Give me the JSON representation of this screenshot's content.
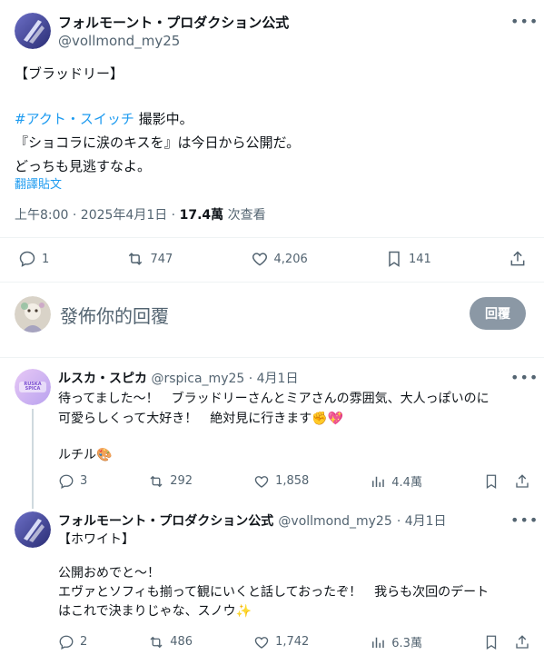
{
  "main_post": {
    "author_name": "フォルモーント・プロダクション公式",
    "author_handle": "@vollmond_my25",
    "line1": "【ブラッドリー】",
    "hashtag": "#アクト・スイッチ",
    "line2_rest": " 撮影中。",
    "line3": "『ショコラに涙のキスを』は今日から公開だ。",
    "line4": "どっちも見逃すなよ。",
    "translate": "翻譯貼文",
    "time": "上午8:00 · 2025年4月1日 · ",
    "views_count": "17.4萬",
    "views_label": " 次查看",
    "replies": "1",
    "reposts": "747",
    "likes": "4,206",
    "bookmarks": "141"
  },
  "composer": {
    "placeholder": "發佈你的回覆",
    "reply_button": "回覆"
  },
  "replies": [
    {
      "author_name": "ルスカ・スピカ",
      "author_handle": "@rspica_my25",
      "date": "· 4月1日",
      "avatar_text": "RUSKA SPICA",
      "line1": "待ってました～！　ブラッドリーさんとミアさんの雰囲気、大人っぽいのに",
      "line2": "可愛らしくって大好き！　絶対見に行きます✊💖",
      "line3": "",
      "line4": "ルチル🎨",
      "replies": "3",
      "reposts": "292",
      "likes": "1,858",
      "views": "4.4萬"
    },
    {
      "author_name": "フォルモーント・プロダクション公式",
      "author_handle": "@vollmond_my25",
      "date": "· 4月1日",
      "line1": "【ホワイト】",
      "line2": "",
      "line3": "公開おめでと～！",
      "line4": "エヴァとソフィも揃って観にいくと話しておったぞ！　我らも次回のデート",
      "line5": "はこれで決まりじゃな、スノウ✨",
      "replies": "2",
      "reposts": "486",
      "likes": "1,742",
      "views": "6.3萬"
    }
  ],
  "colors": {
    "accent": "#1d9bf0",
    "muted": "#536471",
    "divider": "#eff3f4",
    "brand_avatar_bg": "#3c3f8f"
  }
}
